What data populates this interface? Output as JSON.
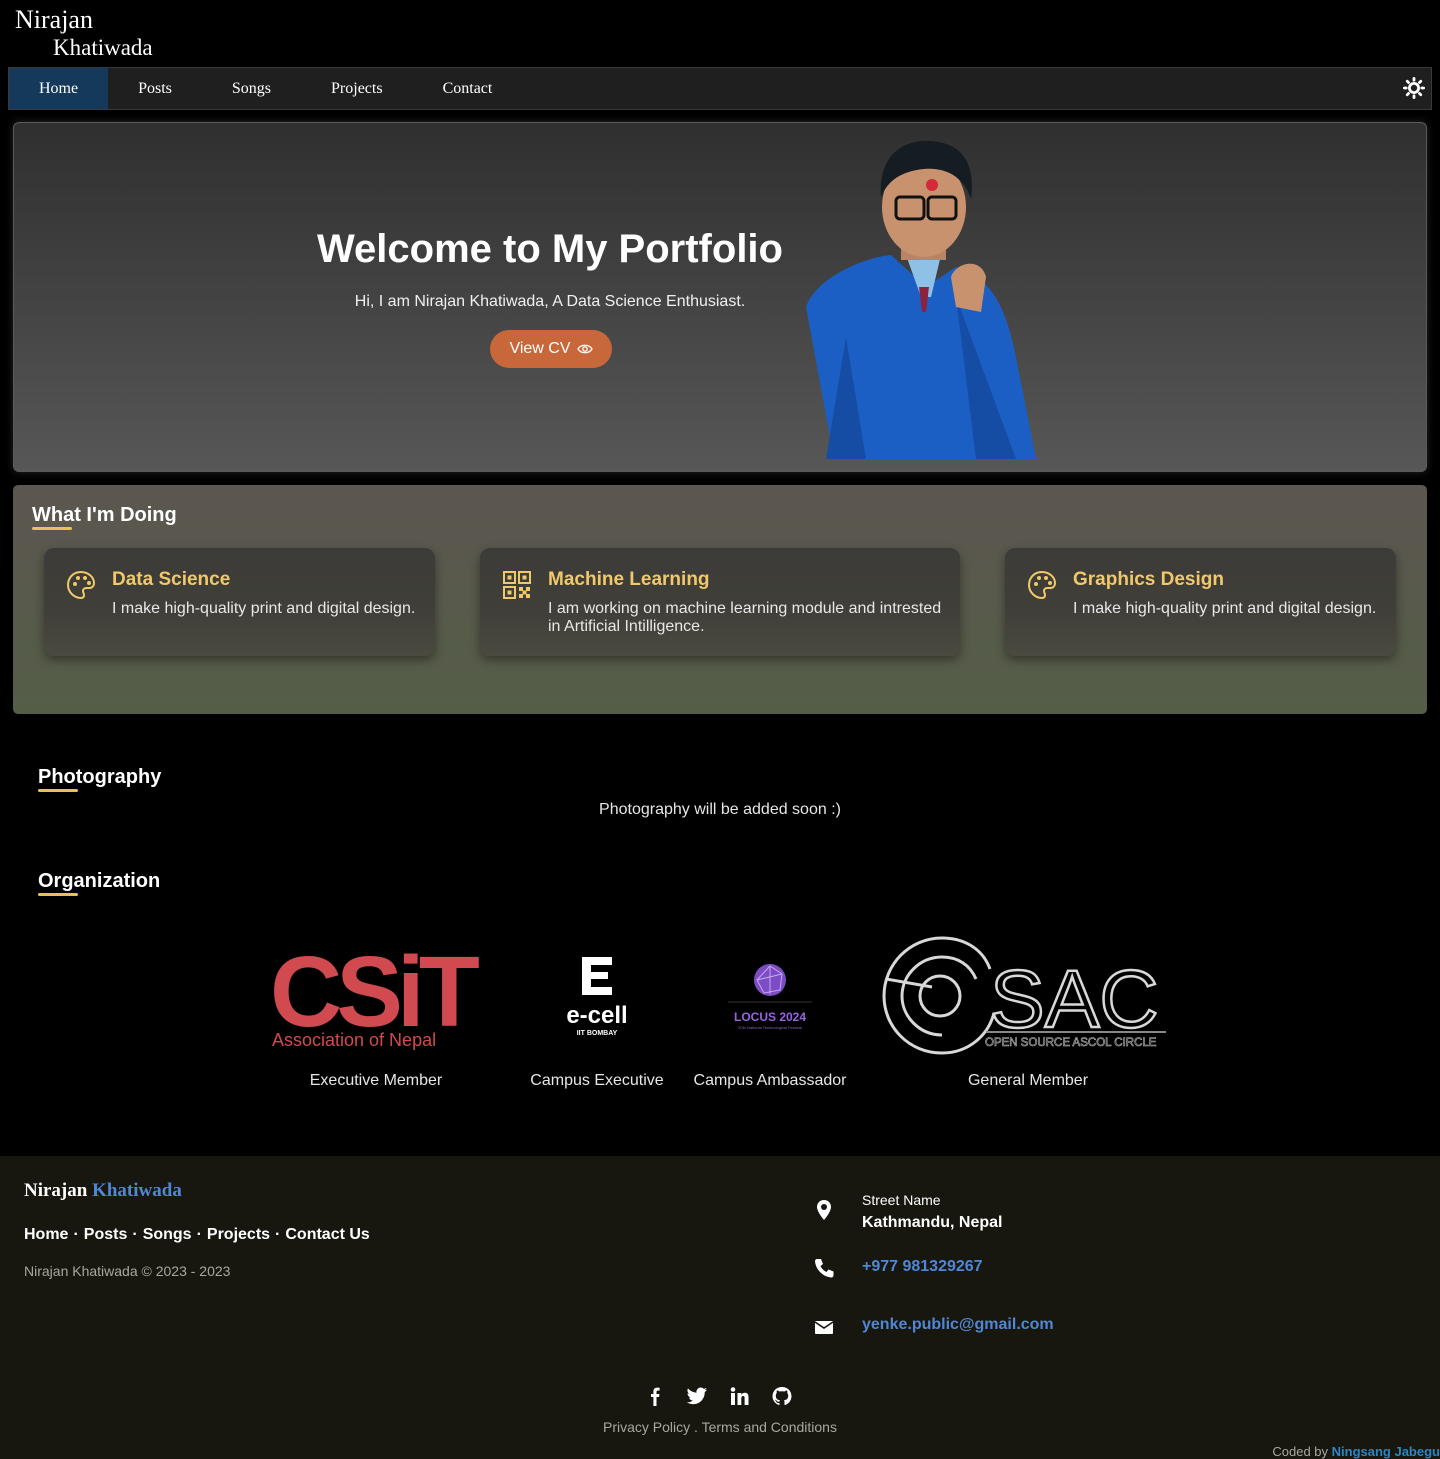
{
  "brand": {
    "first": "Nirajan",
    "last": "Khatiwada"
  },
  "nav": {
    "items": [
      {
        "label": "Home"
      },
      {
        "label": "Posts"
      },
      {
        "label": "Songs"
      },
      {
        "label": "Projects"
      },
      {
        "label": "Contact"
      }
    ],
    "active": "Home",
    "theme_icon": "sun-icon"
  },
  "hero": {
    "title": "Welcome to My Portfolio",
    "subtitle": "Hi, I am Nirajan Khatiwada, A Data Science Enthusiast.",
    "cv_button": "View CV",
    "cv_icon": "eye-icon"
  },
  "doing": {
    "heading": "What I'm Doing",
    "cards": [
      {
        "icon": "palette-icon",
        "title": "Data Science",
        "desc": "I make high-quality print and digital design."
      },
      {
        "icon": "qrcode-icon",
        "title": "Machine Learning",
        "desc": "I am working on machine learning module and intrested in Artificial Intilligence."
      },
      {
        "icon": "palette-icon",
        "title": "Graphics Design",
        "desc": "I make high-quality print and digital design."
      }
    ]
  },
  "photography": {
    "heading": "Photography",
    "text": "Photography will be added soon :)"
  },
  "organization": {
    "heading": "Organization",
    "items": [
      {
        "logo_main": "CSiT",
        "logo_sub": "Association of Nepal",
        "role": "Executive Member"
      },
      {
        "logo_main": "e-cell",
        "logo_sub": "IIT BOMBAY",
        "role": "Campus Executive"
      },
      {
        "logo_main": "LOCUS 2024",
        "logo_sub": "20th National Technological Festival",
        "role": "Campus Ambassador"
      },
      {
        "logo_main": "SAC",
        "logo_sub": "OPEN SOURCE ASCOL CIRCLE",
        "role": "General Member"
      }
    ]
  },
  "footer": {
    "brand_first": "Nirajan",
    "brand_last": "Khatiwada",
    "links": [
      "Home",
      "Posts",
      "Songs",
      "Projects",
      "Contact Us"
    ],
    "separator": "·",
    "copyright": "Nirajan Khatiwada © 2023 - 2023",
    "address_label": "Street Name",
    "address": "Kathmandu, Nepal",
    "phone": "+977 981329267",
    "email": "yenke.public@gmail.com",
    "social": [
      "facebook-icon",
      "twitter-icon",
      "linkedin-icon",
      "github-icon"
    ],
    "policy": "Privacy Policy . Terms and Conditions",
    "coded_by_label": "Coded by",
    "coded_by_name": "Ningsang Jabegu"
  },
  "colors": {
    "accent_gold": "#f1c86a",
    "underline": "#e8c15a",
    "cv_button": "#c8683a",
    "nav_active": "#14395a",
    "footer_link": "#4f87d6"
  }
}
